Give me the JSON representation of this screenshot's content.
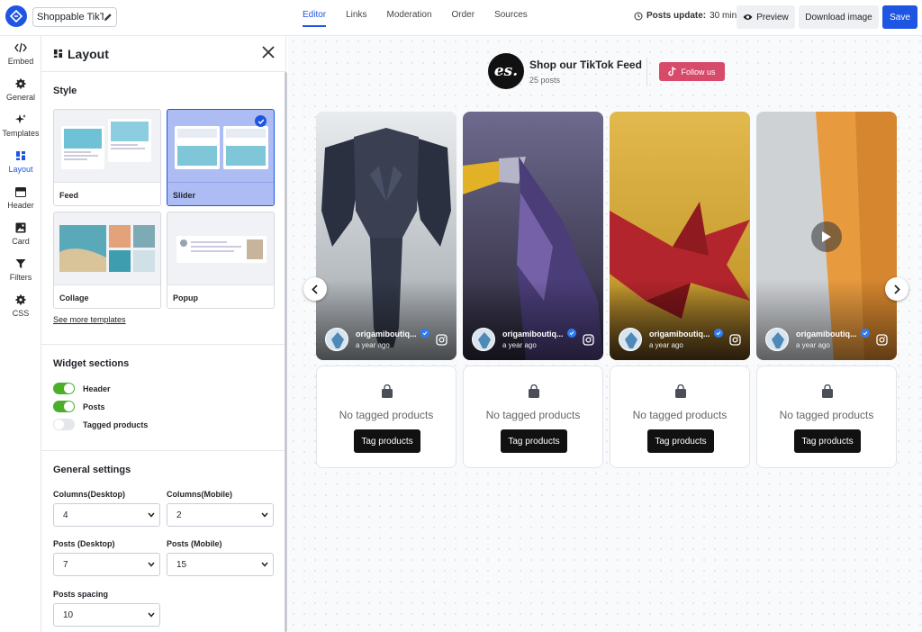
{
  "app": {
    "widget_title": "Shoppable TikT...",
    "tabs": [
      "Editor",
      "Links",
      "Moderation",
      "Order",
      "Sources"
    ],
    "posts_update_label": "Posts update:",
    "posts_update_value": "30 min",
    "preview_label": "Preview",
    "download_label": "Download image",
    "save_label": "Save",
    "accent_color": "#1e56e3"
  },
  "rail": {
    "items": [
      "Embed",
      "General",
      "Templates",
      "Layout",
      "Header",
      "Card",
      "Filters",
      "CSS"
    ]
  },
  "panel": {
    "title": "Layout",
    "style_title": "Style",
    "styles": [
      "Feed",
      "Slider",
      "Collage",
      "Popup"
    ],
    "selected_style": "Slider",
    "see_more": "See more templates",
    "sections_title": "Widget sections",
    "sections": [
      {
        "label": "Header",
        "on": true
      },
      {
        "label": "Posts",
        "on": true
      },
      {
        "label": "Tagged products",
        "on": false
      }
    ],
    "general_title": "General settings",
    "fields": {
      "columns_desktop": {
        "label": "Columns(Desktop)",
        "value": "4"
      },
      "columns_mobile": {
        "label": "Columns(Mobile)",
        "value": "2"
      },
      "posts_desktop": {
        "label": "Posts (Desktop)",
        "value": "7"
      },
      "posts_mobile": {
        "label": "Posts (Mobile)",
        "value": "15"
      },
      "posts_spacing": {
        "label": "Posts spacing",
        "value": "10"
      }
    }
  },
  "feed": {
    "logo_text": "es.",
    "title": "Shop our TikTok Feed",
    "posts_count": "25 posts",
    "follow_label": "Follow us",
    "posts": [
      {
        "username": "origamiboutiq...",
        "time": "a year ago"
      },
      {
        "username": "origamiboutiq...",
        "time": "a year ago"
      },
      {
        "username": "origamiboutiq...",
        "time": "a year ago"
      },
      {
        "username": "origamiboutiq...",
        "time": "a year ago"
      }
    ],
    "no_products": "No tagged products",
    "tag_products": "Tag products"
  }
}
